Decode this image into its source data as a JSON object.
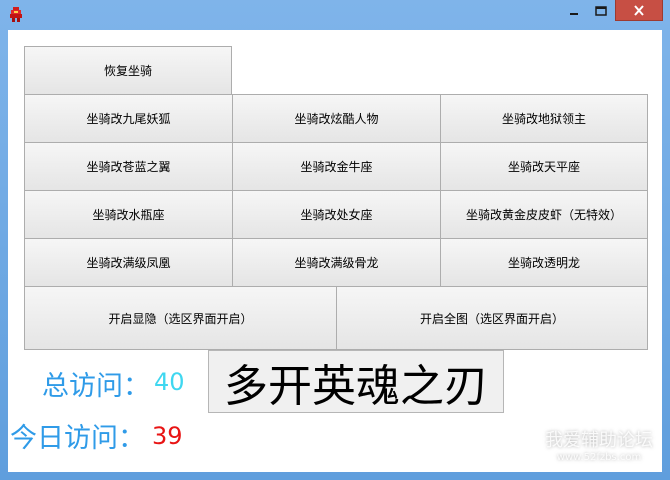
{
  "window": {
    "icons": {
      "app": "app-icon",
      "minimize": "minimize-icon",
      "maximize": "maximize-icon",
      "close": "close-icon"
    },
    "colors": {
      "title_bar": "#6aa6e0",
      "close_button": "#c74f44"
    }
  },
  "buttons": {
    "restore": "恢复坐骑",
    "grid": [
      [
        "坐骑改九尾妖狐",
        "坐骑改炫酷人物",
        "坐骑改地狱领主"
      ],
      [
        "坐骑改苍蓝之翼",
        "坐骑改金牛座",
        "坐骑改天平座"
      ],
      [
        "坐骑改水瓶座",
        "坐骑改处女座",
        "坐骑改黄金皮皮虾（无特效）"
      ],
      [
        "坐骑改满级凤凰",
        "坐骑改满级骨龙",
        "坐骑改透明龙"
      ]
    ],
    "show_hide": "开启显隐（选区界面开启）",
    "full_map": "开启全图（选区界面开启）"
  },
  "stats": {
    "total_label": "总访问：",
    "total_value": "40",
    "today_label": "今日访问：",
    "today_value": "39",
    "colors": {
      "label": "#2f9be8",
      "total_value": "#3fd7f0",
      "today_value": "#e81414"
    }
  },
  "banner": {
    "text": "多开英魂之刃"
  },
  "watermark": {
    "title": "我爱辅助论坛",
    "url": "www.52fzbs.com"
  }
}
